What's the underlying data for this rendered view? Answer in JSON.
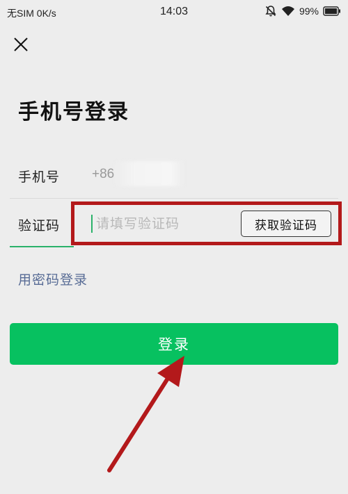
{
  "status_bar": {
    "carrier": "无SIM 0K/s",
    "time": "14:03",
    "battery": "99%"
  },
  "icons": {
    "close": "close-icon",
    "mute": "bell-off-icon",
    "wifi": "wifi-icon",
    "battery": "battery-icon"
  },
  "page": {
    "title": "手机号登录"
  },
  "phone_field": {
    "label": "手机号",
    "value": "+86"
  },
  "code_field": {
    "label": "验证码",
    "placeholder": "请填写验证码",
    "get_code_label": "获取验证码"
  },
  "password_login_link": "用密码登录",
  "login_button_label": "登录",
  "colors": {
    "primary_green": "#07c160",
    "link_blue": "#576b95",
    "highlight_red": "#b3191b",
    "background": "#ededed"
  }
}
